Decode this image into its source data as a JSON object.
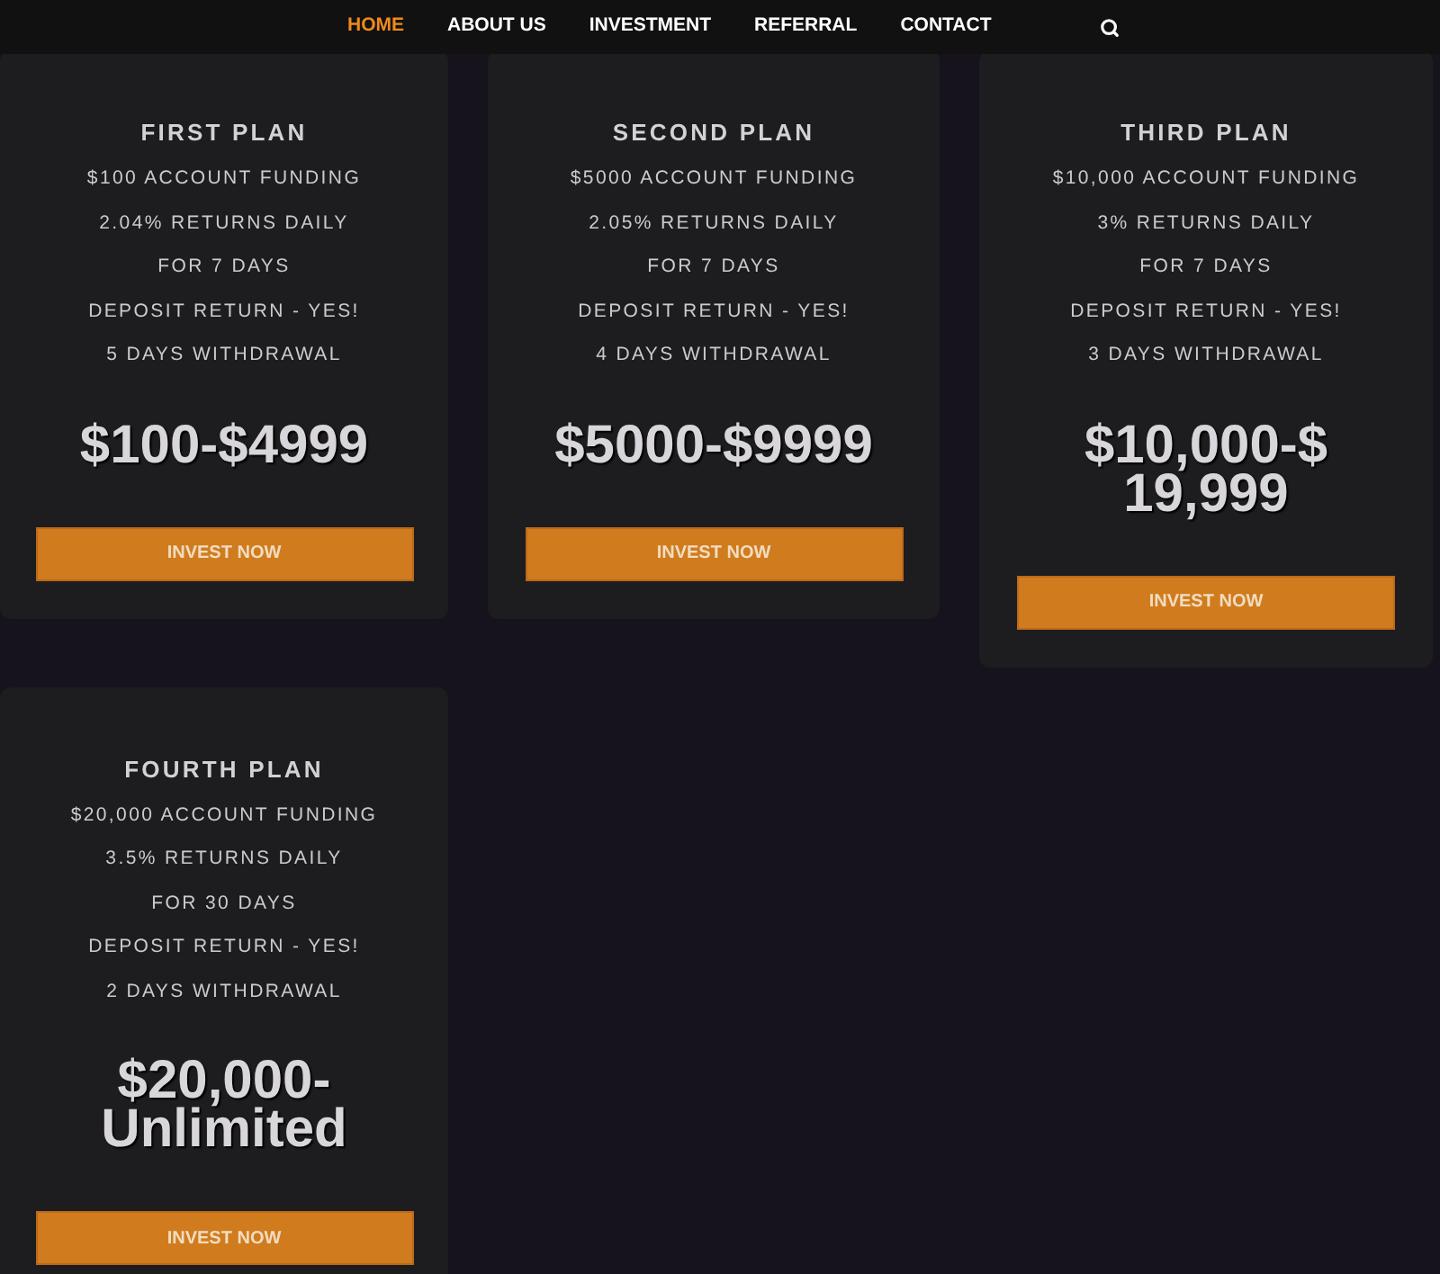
{
  "nav": {
    "items": [
      {
        "label": "HOME",
        "selected": true
      },
      {
        "label": "ABOUT US",
        "selected": false
      },
      {
        "label": "INVESTMENT",
        "selected": false
      },
      {
        "label": "REFERRAL",
        "selected": false
      },
      {
        "label": "CONTACT",
        "selected": false
      }
    ]
  },
  "plans": [
    {
      "title": "FIRST PLAN",
      "features": [
        "$100 ACCOUNT FUNDING",
        "2.04% RETURNS DAILY",
        "FOR 7 DAYS",
        "DEPOSIT RETURN - YES!",
        "5 DAYS WITHDRAWAL"
      ],
      "price": [
        "$100-$4999"
      ],
      "button": "INVEST NOW"
    },
    {
      "title": "SECOND PLAN",
      "features": [
        "$5000 ACCOUNT FUNDING",
        "2.05% RETURNS DAILY",
        "FOR 7 DAYS",
        "DEPOSIT RETURN - YES!",
        "4 DAYS WITHDRAWAL"
      ],
      "price": [
        "$5000-$9999"
      ],
      "button": "INVEST NOW"
    },
    {
      "title": "THIRD PLAN",
      "features": [
        "$10,000 ACCOUNT FUNDING",
        "3% RETURNS DAILY",
        "FOR 7 DAYS",
        "DEPOSIT RETURN - YES!",
        "3 DAYS WITHDRAWAL"
      ],
      "price": [
        "$10,000-$",
        "19,999"
      ],
      "button": "INVEST NOW"
    },
    {
      "title": "FOURTH PLAN",
      "features": [
        "$20,000 ACCOUNT FUNDING",
        "3.5% RETURNS DAILY",
        "FOR 30 DAYS",
        "DEPOSIT RETURN - YES!",
        "2 DAYS WITHDRAWAL"
      ],
      "price": [
        "$20,000-",
        "Unlimited"
      ],
      "button": "INVEST NOW"
    }
  ]
}
